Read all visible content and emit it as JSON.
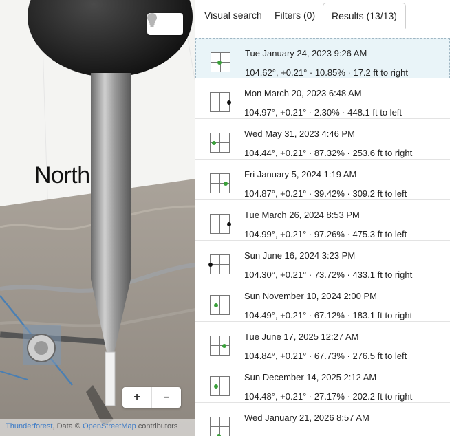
{
  "map": {
    "north_label": "North",
    "zoom_in_label": "+",
    "zoom_out_label": "–",
    "hint_icon": "lightbulb-icon",
    "attribution": {
      "provider": "Thunderforest",
      "middle": ", Data © ",
      "source": "OpenStreetMap",
      "suffix": " contributors"
    }
  },
  "tabs": [
    {
      "label": "Visual search"
    },
    {
      "label": "Filters (0)"
    },
    {
      "label": "Results (13/13)"
    }
  ],
  "colors": {
    "dot_green": "#3aa03a",
    "dot_black": "#111111",
    "link_blue": "#3a7ac7"
  },
  "results": [
    {
      "date": "Tue January 24, 2023 9:26 AM",
      "info": "104.62°, +0.21° · 10.85% · 17.2 ft to right",
      "dot_x": 0.45,
      "dot_y": 0.5,
      "dot_color": "green"
    },
    {
      "date": "Mon March 20, 2023 6:48 AM",
      "info": "104.97°, +0.21° · 2.30% · 448.1 ft to left",
      "dot_x": 1.0,
      "dot_y": 0.5,
      "dot_color": "black"
    },
    {
      "date": "Wed May 31, 2023 4:46 PM",
      "info": "104.44°, +0.21° · 87.32% · 253.6 ft to right",
      "dot_x": 0.2,
      "dot_y": 0.5,
      "dot_color": "green"
    },
    {
      "date": "Fri January 5, 2024 1:19 AM",
      "info": "104.87°, +0.21° · 39.42% · 309.2 ft to left",
      "dot_x": 0.8,
      "dot_y": 0.5,
      "dot_color": "green"
    },
    {
      "date": "Tue March 26, 2024 8:53 PM",
      "info": "104.99°, +0.21° · 97.26% · 475.3 ft to left",
      "dot_x": 1.0,
      "dot_y": 0.5,
      "dot_color": "black"
    },
    {
      "date": "Sun June 16, 2024 3:23 PM",
      "info": "104.30°, +0.21° · 73.72% · 433.1 ft to right",
      "dot_x": 0.0,
      "dot_y": 0.5,
      "dot_color": "black"
    },
    {
      "date": "Sun November 10, 2024 2:00 PM",
      "info": "104.49°, +0.21° · 67.12% · 183.1 ft to right",
      "dot_x": 0.3,
      "dot_y": 0.5,
      "dot_color": "green"
    },
    {
      "date": "Tue June 17, 2025 12:27 AM",
      "info": "104.84°, +0.21° · 67.73% · 276.5 ft to left",
      "dot_x": 0.75,
      "dot_y": 0.5,
      "dot_color": "green"
    },
    {
      "date": "Sun December 14, 2025 2:12 AM",
      "info": "104.48°, +0.21° · 27.17% · 202.2 ft to right",
      "dot_x": 0.3,
      "dot_y": 0.5,
      "dot_color": "green"
    },
    {
      "date": "Wed January 21, 2026 8:57 AM",
      "info": "",
      "dot_x": 0.45,
      "dot_y": 1.0,
      "dot_color": "green"
    }
  ]
}
